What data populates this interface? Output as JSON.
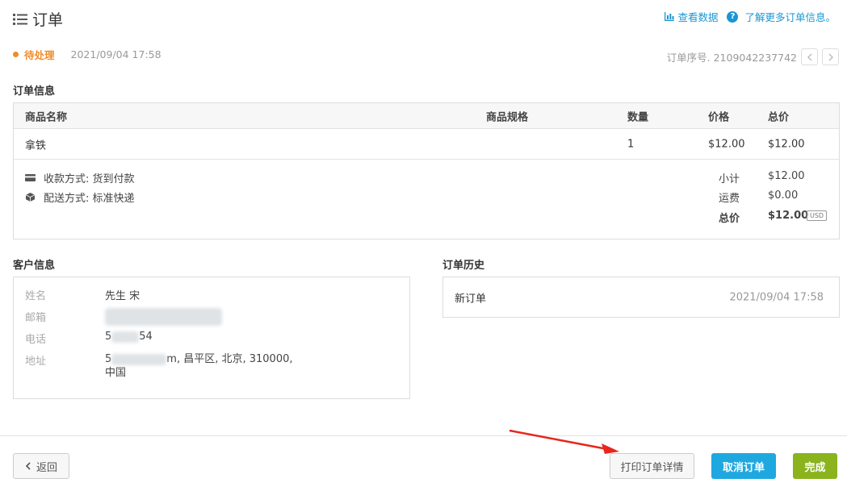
{
  "header": {
    "title": "订单",
    "view_data_link": "查看数据",
    "learn_more_link": "了解更多订单信息。"
  },
  "status": {
    "label": "待处理",
    "datetime": "2021/09/04 17:58",
    "color": "#f08c2b"
  },
  "order_nav": {
    "label": "订单序号. 2109042237742"
  },
  "order_info": {
    "section_title": "订单信息",
    "columns": [
      "商品名称",
      "商品规格",
      "数量",
      "价格",
      "总价"
    ],
    "rows": [
      {
        "name": "拿铁",
        "spec": "",
        "qty": "1",
        "price": "$12.00",
        "total": "$12.00"
      }
    ],
    "payment": "收款方式: 货到付款",
    "shipping": "配送方式: 标准快递",
    "subtotal_label": "小计",
    "subtotal_value": "$12.00",
    "freight_label": "运费",
    "freight_value": "$0.00",
    "grand_total_label": "总价",
    "grand_total_value": "$12.00",
    "currency_badge": "USD"
  },
  "customer": {
    "section_title": "客户信息",
    "name_label": "姓名",
    "name_value": "先生 宋",
    "email_label": "邮箱",
    "phone_label": "电话",
    "phone_prefix": "5",
    "phone_suffix": "54",
    "address_label": "地址",
    "address_prefix": "5",
    "address_suffix": "m, 昌平区, 北京, 310000,",
    "address_line2": "中国"
  },
  "history": {
    "section_title": "订单历史",
    "entries": [
      {
        "event": "新订单",
        "time": "2021/09/04 17:58"
      }
    ]
  },
  "footer": {
    "back_label": "返回",
    "print_label": "打印订单详情",
    "cancel_label": "取消订单",
    "done_label": "完成"
  },
  "colors": {
    "link": "#1a96d4",
    "cancel_button": "#1fa8e0",
    "done_button": "#8ab31d",
    "annotation_arrow": "#e8261c"
  }
}
